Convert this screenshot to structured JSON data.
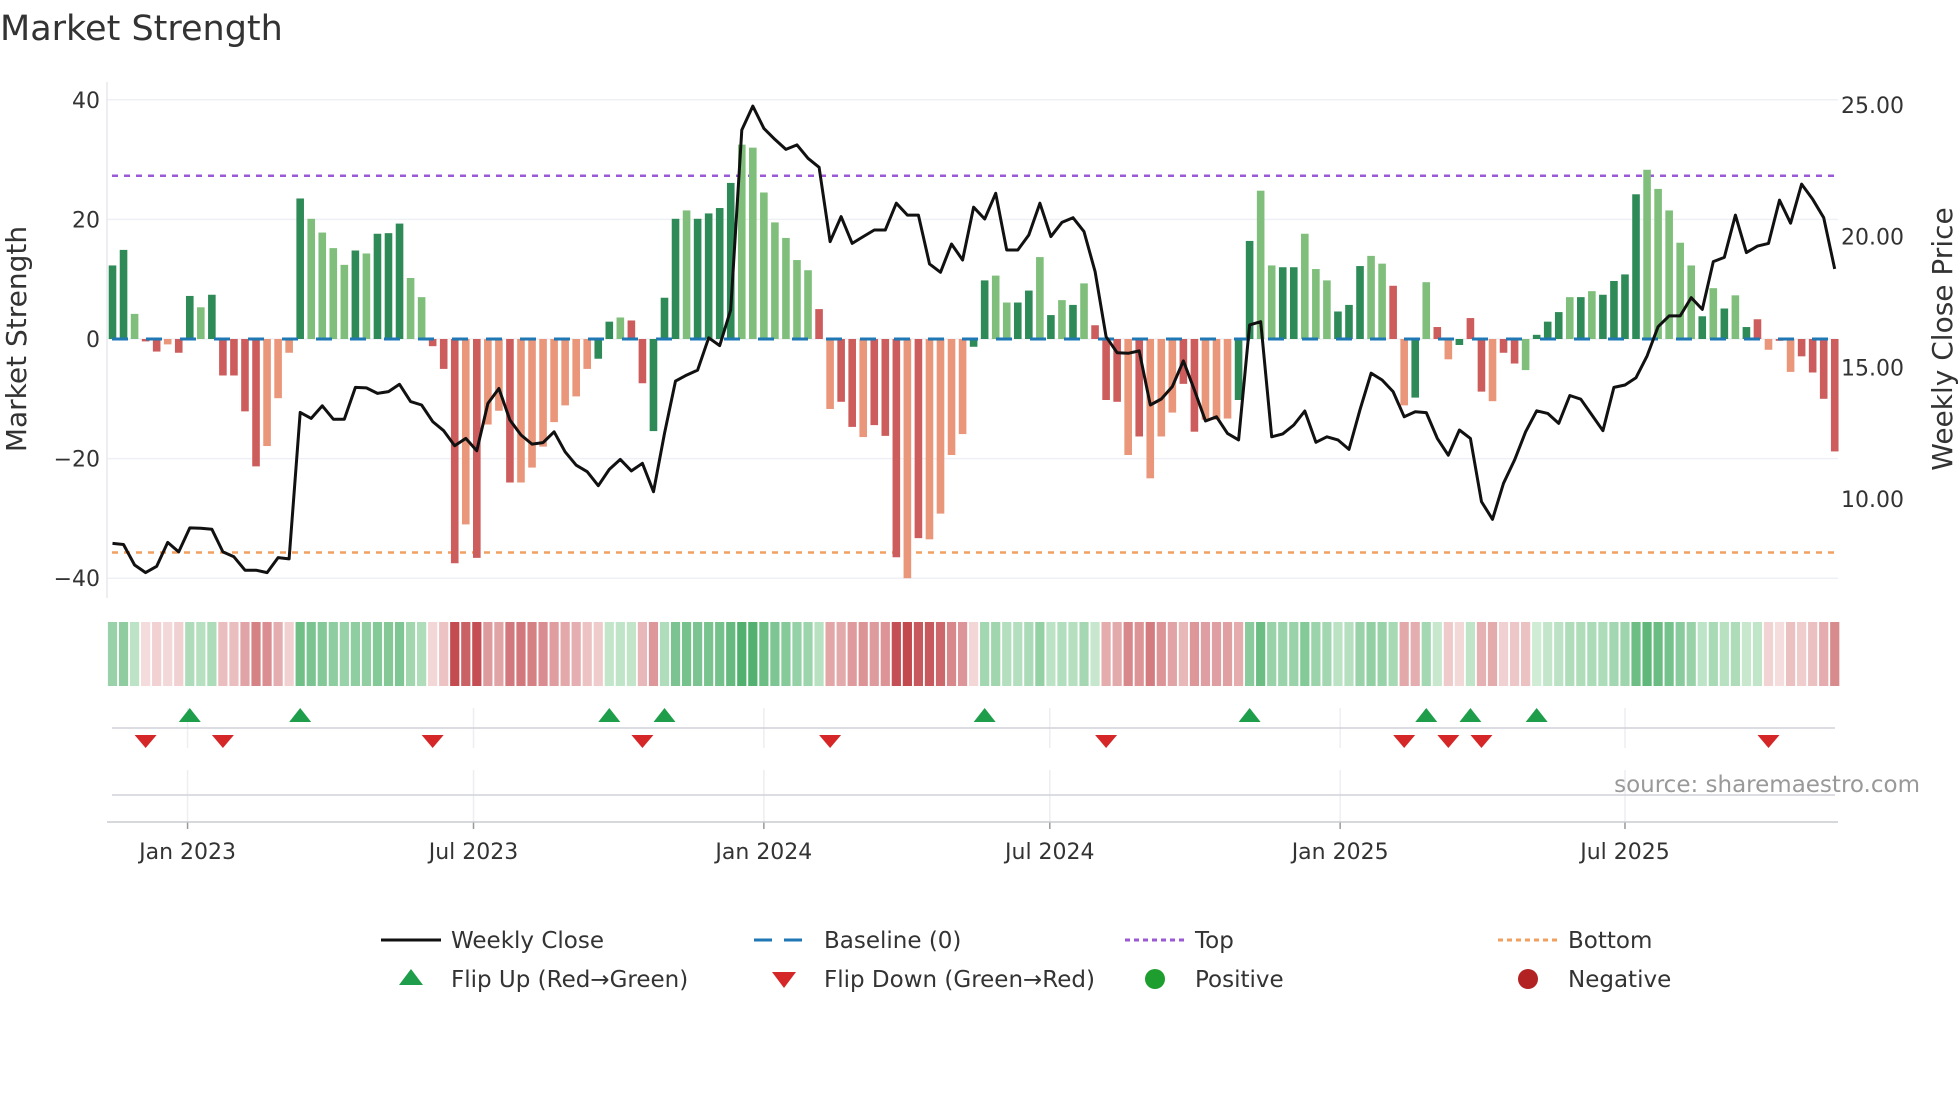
{
  "title": "Market Strength",
  "source": "source: sharemaestro.com",
  "colors": {
    "bar_G": "#2e8b57",
    "bar_g": "#7fbf7b",
    "bar_R": "#cd5c5c",
    "bar_r": "#e9967a",
    "price": "#111111",
    "baseline": "#1f77b4",
    "top": "#9b59d6",
    "bottom": "#f0a060",
    "flip_up": "#1e9e4a",
    "flip_down": "#d62728",
    "positive": "#1e9e2e",
    "negative": "#b22222",
    "heat_green_light": "#d6efda",
    "heat_green_dark": "#3fa860",
    "heat_red_light": "#f6e0e0",
    "heat_red_dark": "#c24a4f"
  },
  "chart_data": {
    "type": "bar",
    "title": "Market Strength",
    "ylabel": "Market Strength",
    "y2label": "Weekly Close Price",
    "ylim": [
      -40,
      40
    ],
    "y2lim": [
      7.5,
      25.0
    ],
    "yticks": [
      {
        "v": 40,
        "label": "40"
      },
      {
        "v": 20,
        "label": "20"
      },
      {
        "v": 0,
        "label": "0"
      },
      {
        "v": -20,
        "label": "−20"
      },
      {
        "v": -40,
        "label": "−40"
      }
    ],
    "y2ticks": [
      {
        "v": 25,
        "label": "25.00"
      },
      {
        "v": 20,
        "label": "20.00"
      },
      {
        "v": 15,
        "label": "15.00"
      },
      {
        "v": 10,
        "label": "10.00"
      }
    ],
    "xticks": [
      {
        "week": 6.8,
        "label": "Jan 2023"
      },
      {
        "week": 32.7,
        "label": "Jul 2023"
      },
      {
        "week": 59.0,
        "label": "Jan 2024"
      },
      {
        "week": 84.9,
        "label": "Jul 2024"
      },
      {
        "week": 111.2,
        "label": "Jan 2025"
      },
      {
        "week": 137.0,
        "label": "Jul 2025"
      }
    ],
    "top_level": 27.3,
    "bottom_level": -35.7,
    "baseline": 0,
    "strength": [
      12.3,
      14.9,
      4.2,
      -0.4,
      -2.1,
      -0.9,
      -2.3,
      7.2,
      5.3,
      7.4,
      -6.1,
      -6.1,
      -12.1,
      -21.3,
      -17.9,
      -9.9,
      -2.3,
      23.5,
      20.1,
      17.8,
      15.2,
      12.4,
      14.8,
      14.3,
      17.6,
      17.7,
      19.3,
      10.2,
      7.0,
      -1.2,
      -5.0,
      -37.5,
      -31.0,
      -36.6,
      -14.3,
      -12.0,
      -24.0,
      -24.0,
      -21.5,
      -18.0,
      -13.9,
      -11.1,
      -9.6,
      -5.0,
      -3.3,
      2.9,
      3.6,
      3.1,
      -7.4,
      -15.4,
      6.9,
      20.1,
      21.5,
      20.1,
      21.0,
      21.9,
      26.1,
      32.5,
      32.0,
      24.5,
      19.5,
      16.9,
      13.2,
      11.5,
      5.0,
      -11.7,
      -10.5,
      -14.7,
      -16.4,
      -14.4,
      -16.2,
      -36.5,
      -40.0,
      -33.3,
      -33.5,
      -29.2,
      -19.4,
      -15.9,
      -1.3,
      9.8,
      10.6,
      6.1,
      6.1,
      8.1,
      13.7,
      4.0,
      6.5,
      5.7,
      9.3,
      2.3,
      -10.2,
      -10.5,
      -19.4,
      -16.3,
      -23.3,
      -16.3,
      -12.3,
      -7.5,
      -15.5,
      -13.5,
      -13.5,
      -13.3,
      -10.2,
      16.4,
      24.8,
      12.3,
      12.0,
      12.0,
      17.6,
      11.7,
      9.8,
      4.6,
      5.7,
      12.2,
      13.9,
      12.6,
      8.9,
      -11.1,
      -9.8,
      9.5,
      2.0,
      -3.4,
      -1.0,
      3.5,
      -8.8,
      -10.4,
      -2.3,
      -4.1,
      -5.2,
      0.7,
      2.9,
      4.5,
      7.0,
      7.0,
      8.0,
      7.4,
      9.7,
      10.8,
      24.2,
      28.3,
      25.1,
      21.5,
      16.1,
      12.3,
      3.8,
      8.5,
      5.1,
      7.3,
      2.0,
      3.3,
      -1.8,
      -0.3,
      -5.5,
      -2.9,
      -5.6,
      -10.0,
      -18.8
    ],
    "strength_shade": "GGgRRrRGgGRRRRrrrGggggGgGGGggRRRrRrrRrrrrrrrGGgRRGGGgGGGGgggggggRrRRrRRRrRrrrrGGggGGgGgGgRRRrRrrrRRrrrGGggGGgggGGGggRrGgRrGRRrRRgGGGgGgGGGGgggggGgGgGRrRrRRR",
    "weekly_close": [
      8.31,
      8.27,
      7.49,
      7.2,
      7.44,
      8.35,
      7.99,
      8.9,
      8.89,
      8.85,
      7.99,
      7.8,
      7.29,
      7.29,
      7.2,
      7.77,
      7.72,
      13.3,
      13.07,
      13.55,
      13.04,
      13.04,
      14.25,
      14.23,
      14.02,
      14.09,
      14.37,
      13.71,
      13.58,
      12.95,
      12.6,
      12.03,
      12.31,
      11.84,
      13.64,
      14.21,
      13.01,
      12.44,
      12.09,
      12.15,
      12.56,
      11.8,
      11.29,
      11.04,
      10.51,
      11.13,
      11.51,
      11.07,
      11.36,
      10.28,
      12.5,
      14.49,
      14.72,
      14.91,
      16.14,
      15.84,
      17.2,
      24.05,
      24.96,
      24.11,
      23.69,
      23.31,
      23.48,
      22.97,
      22.63,
      19.8,
      20.75,
      19.73,
      19.99,
      20.24,
      20.24,
      21.26,
      20.81,
      20.81,
      18.95,
      18.63,
      19.71,
      19.1,
      21.11,
      20.66,
      21.64,
      19.48,
      19.48,
      20.05,
      21.26,
      19.99,
      20.53,
      20.71,
      20.18,
      18.66,
      16.18,
      15.57,
      15.55,
      15.64,
      13.58,
      13.81,
      14.28,
      15.26,
      14.15,
      12.97,
      13.13,
      12.5,
      12.25,
      16.63,
      16.75,
      12.37,
      12.48,
      12.82,
      13.35,
      12.16,
      12.37,
      12.25,
      11.89,
      13.4,
      14.79,
      14.53,
      14.09,
      13.13,
      13.32,
      13.29,
      12.31,
      11.67,
      12.63,
      12.31,
      9.9,
      9.23,
      10.6,
      11.49,
      12.56,
      13.36,
      13.26,
      12.88,
      13.94,
      13.8,
      13.2,
      12.6,
      14.25,
      14.34,
      14.62,
      15.45,
      16.56,
      16.97,
      16.97,
      17.67,
      17.22,
      19.04,
      19.2,
      20.81,
      19.38,
      19.63,
      19.73,
      21.38,
      20.5,
      21.99,
      21.41,
      20.71,
      18.76
    ],
    "legend": [
      {
        "key": "close",
        "label": "Weekly Close"
      },
      {
        "key": "baseline",
        "label": "Baseline (0)"
      },
      {
        "key": "top",
        "label": "Top"
      },
      {
        "key": "bottom",
        "label": "Bottom"
      },
      {
        "key": "flip_up",
        "label": "Flip Up (Red→Green)"
      },
      {
        "key": "flip_down",
        "label": "Flip Down (Green→Red)"
      },
      {
        "key": "positive",
        "label": "Positive"
      },
      {
        "key": "negative",
        "label": "Negative"
      }
    ],
    "legend_position": "bottom"
  }
}
